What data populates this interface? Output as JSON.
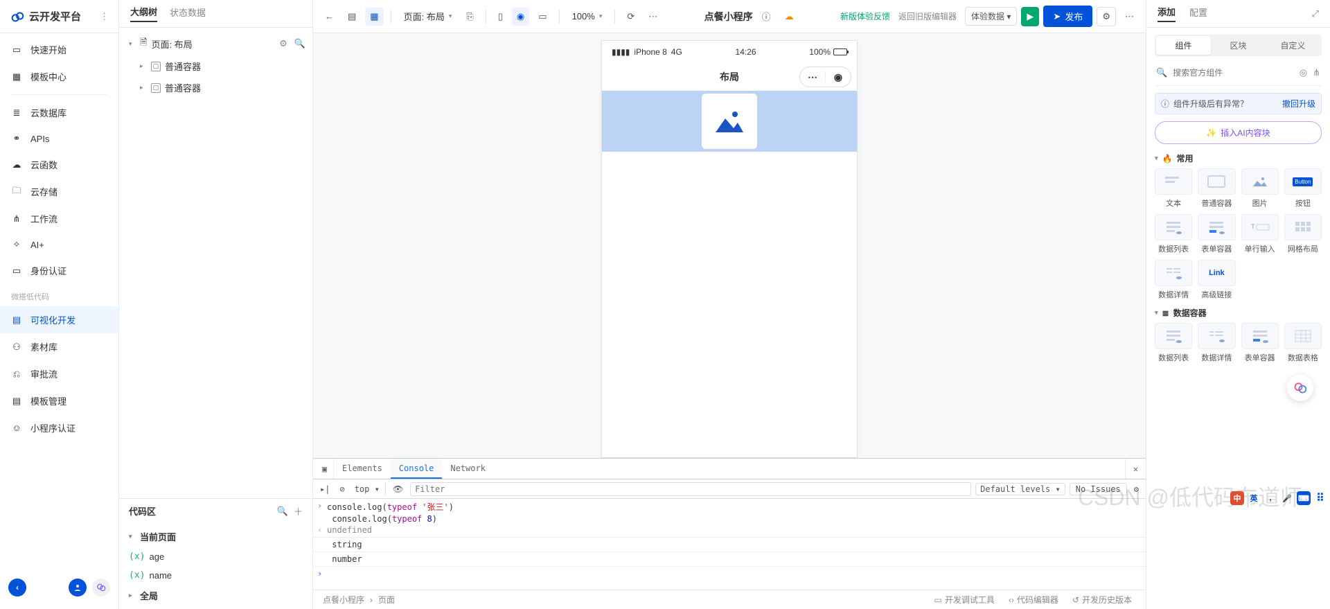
{
  "brand": "云开发平台",
  "sidebar": {
    "items": [
      {
        "label": "快速开始"
      },
      {
        "label": "模板中心"
      }
    ],
    "group2": [
      {
        "label": "云数据库"
      },
      {
        "label": "APIs"
      },
      {
        "label": "云函数"
      },
      {
        "label": "云存储"
      },
      {
        "label": "工作流"
      },
      {
        "label": "AI+"
      },
      {
        "label": "身份认证"
      }
    ],
    "group3_label": "微搭低代码",
    "group3": [
      {
        "label": "可视化开发"
      },
      {
        "label": "素材库"
      },
      {
        "label": "审批流"
      },
      {
        "label": "模板管理"
      },
      {
        "label": "小程序认证"
      }
    ]
  },
  "mid": {
    "tabs": {
      "outline": "大纲树",
      "state": "状态数据"
    },
    "tree": {
      "page": "页面: 布局",
      "node1": "普通容器",
      "node2": "普通容器"
    },
    "code": {
      "title": "代码区",
      "group_current": "当前页面",
      "vars": [
        {
          "name": "age"
        },
        {
          "name": "name"
        }
      ],
      "group_global": "全局"
    }
  },
  "toolbar": {
    "page_selector": "页面: 布局",
    "zoom": "100%",
    "app_title": "点餐小程序",
    "feedback": "新版体验反馈",
    "back_old": "返回旧版编辑器",
    "data_btn": "体验数据",
    "publish": "发布"
  },
  "phone": {
    "device": "iPhone 8",
    "network": "4G",
    "time": "14:26",
    "battery": "100%",
    "nav_title": "布局"
  },
  "devtools": {
    "tabs": {
      "elements": "Elements",
      "console": "Console",
      "network": "Network"
    },
    "top": "top",
    "filter_placeholder": "Filter",
    "levels": "Default levels",
    "no_issues": "No Issues",
    "lines": {
      "l1a": "console.log(",
      "l1b": "typeof",
      "l1c": "'张三'",
      "l1d": ")",
      "l2a": "console.log(",
      "l2b": "typeof",
      "l2c": "8",
      "l2d": ")",
      "undef": "undefined",
      "out1": "string",
      "out2": "number"
    }
  },
  "footer": {
    "crumb1": "点餐小程序",
    "crumb2": "页面",
    "tools": "开发调试工具",
    "editor": "代码编辑器",
    "history": "开发历史版本"
  },
  "right": {
    "tabs": {
      "add": "添加",
      "config": "配置"
    },
    "segments": {
      "component": "组件",
      "block": "区块",
      "custom": "自定义"
    },
    "search_ph": "搜索官方组件",
    "notice_text": "组件升级后有异常？",
    "notice_link": "撤回升级",
    "ai_btn": "插入AI内容块",
    "sections": {
      "common": "常用",
      "data_container": "数据容器"
    },
    "common_items": [
      {
        "label": "文本"
      },
      {
        "label": "普通容器"
      },
      {
        "label": "图片"
      },
      {
        "label": "按钮"
      },
      {
        "label": "数据列表"
      },
      {
        "label": "表单容器"
      },
      {
        "label": "单行输入"
      },
      {
        "label": "网格布局"
      },
      {
        "label": "数据详情"
      },
      {
        "label": "高级链接"
      }
    ],
    "data_items": [
      {
        "label": "数据列表"
      },
      {
        "label": "数据详情"
      },
      {
        "label": "表单容器"
      },
      {
        "label": "数据表格"
      }
    ],
    "btn_thumb": "Button",
    "link_thumb": "Link"
  },
  "watermark": "CSDN @低代码布道师",
  "tray": {
    "ch": "中",
    "en": "英"
  }
}
